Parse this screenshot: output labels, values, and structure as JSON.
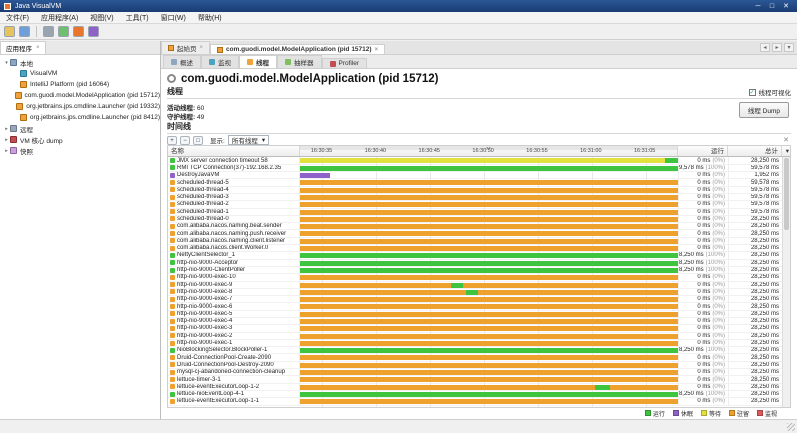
{
  "window": {
    "title": "Java VisualVM",
    "minimize": "─",
    "maximize": "□",
    "close": "✕"
  },
  "menu": {
    "items": [
      "文件(F)",
      "应用程序(A)",
      "视图(V)",
      "工具(T)",
      "窗口(W)",
      "帮助(H)"
    ]
  },
  "toolbar": {
    "icons": [
      "open-snapshot-icon",
      "save-all-icon",
      "snapshot-camera-icon",
      "gc-icon",
      "heap-dump-icon",
      "thread-dump-icon"
    ]
  },
  "sidebar": {
    "tab_title": "应用程序",
    "tab_close": "×",
    "tree": [
      {
        "label": "本地",
        "icon": "local",
        "level": 0,
        "expanded": true
      },
      {
        "label": "VisualVM",
        "icon": "vvm",
        "level": 1
      },
      {
        "label": "IntelliJ Platform (pid 16064)",
        "icon": "app",
        "level": 1
      },
      {
        "label": "com.guodi.model.ModelApplication (pid 15712)",
        "icon": "app",
        "level": 1
      },
      {
        "label": "org.jetbrains.jps.cmdline.Launcher (pid 19332)",
        "icon": "app",
        "level": 1
      },
      {
        "label": "org.jetbrains.jps.cmdline.Launcher (pid 8412)",
        "icon": "app",
        "level": 1
      },
      {
        "label": "远程",
        "icon": "remote",
        "level": 0,
        "expanded": false
      },
      {
        "label": "VM 核心 dump",
        "icon": "core",
        "level": 0,
        "expanded": false
      },
      {
        "label": "快照",
        "icon": "snap",
        "level": 0,
        "expanded": false
      }
    ]
  },
  "tabs": [
    {
      "label": "起始页",
      "close": "×",
      "active": false
    },
    {
      "label": "com.guodi.model.ModelApplication (pid 15712)",
      "close": "×",
      "active": true
    }
  ],
  "tab_controls": [
    "◂",
    "▸",
    "▾"
  ],
  "subtabs": [
    {
      "label": "概述",
      "color": "#8fa6c0",
      "active": false
    },
    {
      "label": "监视",
      "color": "#4aa3c0",
      "active": false
    },
    {
      "label": "线程",
      "color": "#f0a23c",
      "active": true
    },
    {
      "label": "抽样器",
      "color": "#7fbf5f",
      "active": false
    },
    {
      "label": "Profiler",
      "color": "#c05050",
      "active": false
    }
  ],
  "content": {
    "heading": "com.guodi.model.ModelApplication (pid 15712)",
    "threads_section": {
      "title": "线程",
      "visualization_label": "线程可视化",
      "checkbox": "✓",
      "live_label": "活动线程:",
      "live_value": "60",
      "daemon_label": "守护线程:",
      "daemon_value": "49",
      "dump_button": "线程 Dump"
    },
    "timeline_section": {
      "title": "时间线",
      "zoom_in": "+",
      "zoom_out": "−",
      "fit": "□",
      "view_label": "显示:",
      "view_value": "所有线程",
      "dropdown_arrow": "▾",
      "close": "✕"
    },
    "state_colors": {
      "run": "#3ec43e",
      "sleep": "#8f62c9",
      "wait": "#e3e13f",
      "park": "#efa12d",
      "monitor": "#e05a5a"
    },
    "table": {
      "name_header": "名称",
      "running_header": "运行",
      "total_header": "总计",
      "column_selector": "▾",
      "mini_scroll_left": "◂",
      "mini_scroll_right": "▸",
      "ticks": [
        "16:30:35",
        "16:30:40",
        "16:30:45",
        "16:30:50",
        "16:30:55",
        "16:31:00",
        "16:31:05"
      ],
      "rows": [
        {
          "n": "JMX server connection timeout 58",
          "run": "0 ms",
          "pct": "(0%)",
          "total": "28,250 ms",
          "seg": [
            [
              "wait",
              96.5
            ],
            [
              "run",
              3.5
            ]
          ]
        },
        {
          "n": "RMI TCP Connection(37)-192.168.2.35",
          "run": "59,578 ms",
          "pct": "(100%)",
          "total": "59,578 ms",
          "seg": [
            [
              "run",
              100
            ]
          ]
        },
        {
          "n": "DestroyJavaVM",
          "run": "0 ms",
          "pct": "(0%)",
          "total": "1,952 ms",
          "seg": [
            [
              "sleep",
              8
            ]
          ]
        },
        {
          "n": "scheduled-thread-5",
          "run": "0 ms",
          "pct": "(0%)",
          "total": "59,578 ms",
          "seg": [
            [
              "park",
              100
            ]
          ]
        },
        {
          "n": "scheduled-thread-4",
          "run": "0 ms",
          "pct": "(0%)",
          "total": "59,578 ms",
          "seg": [
            [
              "park",
              100
            ]
          ]
        },
        {
          "n": "scheduled-thread-3",
          "run": "0 ms",
          "pct": "(0%)",
          "total": "59,578 ms",
          "seg": [
            [
              "park",
              100
            ]
          ]
        },
        {
          "n": "scheduled-thread-2",
          "run": "0 ms",
          "pct": "(0%)",
          "total": "59,578 ms",
          "seg": [
            [
              "park",
              100
            ]
          ]
        },
        {
          "n": "scheduled-thread-1",
          "run": "0 ms",
          "pct": "(0%)",
          "total": "59,578 ms",
          "seg": [
            [
              "park",
              100
            ]
          ]
        },
        {
          "n": "scheduled-thread-0",
          "run": "0 ms",
          "pct": "(0%)",
          "total": "28,250 ms",
          "seg": [
            [
              "park",
              100
            ]
          ]
        },
        {
          "n": "com.alibaba.nacos.naming.beat.sender",
          "run": "0 ms",
          "pct": "(0%)",
          "total": "28,250 ms",
          "seg": [
            [
              "park",
              100
            ]
          ]
        },
        {
          "n": "com.alibaba.nacos.naming.push.receiver",
          "run": "0 ms",
          "pct": "(0%)",
          "total": "28,250 ms",
          "seg": [
            [
              "park",
              100
            ]
          ]
        },
        {
          "n": "com.alibaba.nacos.naming.client.listener",
          "run": "0 ms",
          "pct": "(0%)",
          "total": "28,250 ms",
          "seg": [
            [
              "park",
              100
            ]
          ]
        },
        {
          "n": "com.alibaba.nacos.client.Worker.0",
          "run": "0 ms",
          "pct": "(0%)",
          "total": "28,250 ms",
          "seg": [
            [
              "park",
              100
            ]
          ]
        },
        {
          "n": "NettyClientSelector_1",
          "run": "28,250 ms",
          "pct": "(100%)",
          "total": "28,250 ms",
          "seg": [
            [
              "run",
              100
            ]
          ]
        },
        {
          "n": "http-nio-9000-Acceptor",
          "run": "28,250 ms",
          "pct": "(100%)",
          "total": "28,250 ms",
          "seg": [
            [
              "run",
              100
            ]
          ]
        },
        {
          "n": "http-nio-9000-ClientPoller",
          "run": "28,250 ms",
          "pct": "(100%)",
          "total": "28,250 ms",
          "seg": [
            [
              "run",
              100
            ]
          ]
        },
        {
          "n": "http-nio-9000-exec-10",
          "run": "0 ms",
          "pct": "(0%)",
          "total": "28,250 ms",
          "seg": [
            [
              "park",
              100
            ]
          ]
        },
        {
          "n": "http-nio-9000-exec-9",
          "run": "0 ms",
          "pct": "(0%)",
          "total": "28,250 ms",
          "seg": [
            [
              "park",
              40
            ],
            [
              "run",
              3
            ],
            [
              "park",
              57
            ]
          ]
        },
        {
          "n": "http-nio-9000-exec-8",
          "run": "0 ms",
          "pct": "(0%)",
          "total": "28,250 ms",
          "seg": [
            [
              "park",
              44
            ],
            [
              "run",
              3
            ],
            [
              "park",
              53
            ]
          ]
        },
        {
          "n": "http-nio-9000-exec-7",
          "run": "0 ms",
          "pct": "(0%)",
          "total": "28,250 ms",
          "seg": [
            [
              "park",
              100
            ]
          ]
        },
        {
          "n": "http-nio-9000-exec-6",
          "run": "0 ms",
          "pct": "(0%)",
          "total": "28,250 ms",
          "seg": [
            [
              "park",
              100
            ]
          ]
        },
        {
          "n": "http-nio-9000-exec-5",
          "run": "0 ms",
          "pct": "(0%)",
          "total": "28,250 ms",
          "seg": [
            [
              "park",
              100
            ]
          ]
        },
        {
          "n": "http-nio-9000-exec-4",
          "run": "0 ms",
          "pct": "(0%)",
          "total": "28,250 ms",
          "seg": [
            [
              "park",
              100
            ]
          ]
        },
        {
          "n": "http-nio-9000-exec-3",
          "run": "0 ms",
          "pct": "(0%)",
          "total": "28,250 ms",
          "seg": [
            [
              "park",
              100
            ]
          ]
        },
        {
          "n": "http-nio-9000-exec-2",
          "run": "0 ms",
          "pct": "(0%)",
          "total": "28,250 ms",
          "seg": [
            [
              "park",
              100
            ]
          ]
        },
        {
          "n": "http-nio-9000-exec-1",
          "run": "0 ms",
          "pct": "(0%)",
          "total": "28,250 ms",
          "seg": [
            [
              "park",
              100
            ]
          ]
        },
        {
          "n": "NioBlockingSelector.BlockPoller-1",
          "run": "28,250 ms",
          "pct": "(100%)",
          "total": "28,250 ms",
          "seg": [
            [
              "run",
              100
            ]
          ]
        },
        {
          "n": "Druid-ConnectionPool-Create-2090",
          "run": "0 ms",
          "pct": "(0%)",
          "total": "28,250 ms",
          "seg": [
            [
              "park",
              100
            ]
          ]
        },
        {
          "n": "Druid-ConnectionPool-Destroy-2090",
          "run": "0 ms",
          "pct": "(0%)",
          "total": "28,250 ms",
          "seg": [
            [
              "park",
              100
            ]
          ]
        },
        {
          "n": "mysql-cj-abandoned-connection-cleanup",
          "run": "0 ms",
          "pct": "(0%)",
          "total": "28,250 ms",
          "seg": [
            [
              "park",
              100
            ]
          ]
        },
        {
          "n": "lettuce-timer-3-1",
          "run": "0 ms",
          "pct": "(0%)",
          "total": "28,250 ms",
          "seg": [
            [
              "park",
              100
            ]
          ]
        },
        {
          "n": "lettuce-eventExecutorLoop-1-2",
          "run": "0 ms",
          "pct": "(0%)",
          "total": "28,250 ms",
          "seg": [
            [
              "park",
              78
            ],
            [
              "run",
              4
            ],
            [
              "park",
              18
            ]
          ]
        },
        {
          "n": "lettuce-nioEventLoop-4-1",
          "run": "28,250 ms",
          "pct": "(100%)",
          "total": "28,250 ms",
          "seg": [
            [
              "run",
              100
            ]
          ]
        },
        {
          "n": "lettuce-eventExecutorLoop-1-1",
          "run": "0 ms",
          "pct": "(0%)",
          "total": "28,250 ms",
          "seg": [
            [
              "park",
              100
            ]
          ]
        }
      ]
    },
    "legend": [
      {
        "label": "运行",
        "state": "run"
      },
      {
        "label": "休眠",
        "state": "sleep"
      },
      {
        "label": "等待",
        "state": "wait"
      },
      {
        "label": "驻留",
        "state": "park"
      },
      {
        "label": "监视",
        "state": "monitor"
      }
    ]
  }
}
